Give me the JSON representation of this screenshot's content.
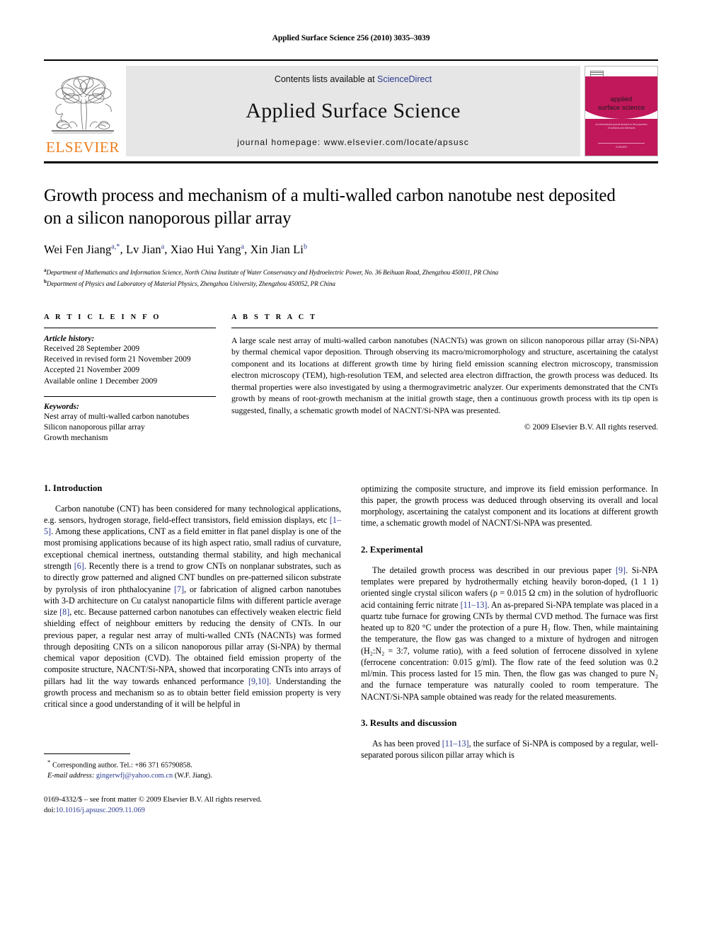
{
  "running_head": "Applied Surface Science 256 (2010) 3035–3039",
  "banner": {
    "contents_prefix": "Contents lists available at ",
    "sciencedirect": "ScienceDirect",
    "journal_name": "Applied Surface Science",
    "homepage": "journal homepage: www.elsevier.com/locate/apsusc",
    "publisher_wordmark": "ELSEVIER",
    "cover": {
      "title_line1": "applied",
      "title_line2": "surface science",
      "subtitle": "An international journal devoted to the properties of surfaces and interfaces",
      "footer": "ELSEVIER",
      "accent_color": "#c0185b"
    },
    "link_color": "#2b3a8f",
    "wordmark_color": "#ef7d1a"
  },
  "article": {
    "title": "Growth process and mechanism of a multi-walled carbon nanotube nest deposited on a silicon nanoporous pillar array",
    "authors_html": "Wei Fen Jiang <sup>a,*</sup>, Lv Jian <sup>a</sup>, Xiao Hui Yang <sup>a</sup>, Xin Jian Li <sup>b</sup>",
    "affiliations": [
      {
        "marker": "a",
        "text": "Department of Mathematics and Information Science, North China Institute of Water Conservancy and Hydroelectric Power, No. 36 Beihuan Road, Zhengzhou 450011, PR China"
      },
      {
        "marker": "b",
        "text": "Department of Physics and Laboratory of Material Physics, Zhengzhou University, Zhengzhou 450052, PR China"
      }
    ]
  },
  "article_info": {
    "label": "A R T I C L E   I N F O",
    "history_head": "Article history:",
    "history": [
      "Received 28 September 2009",
      "Received in revised form 21 November 2009",
      "Accepted 21 November 2009",
      "Available online 1 December 2009"
    ],
    "keywords_head": "Keywords:",
    "keywords": [
      "Nest array of multi-walled carbon nanotubes",
      "Silicon nanoporous pillar array",
      "Growth mechanism"
    ]
  },
  "abstract": {
    "label": "A B S T R A C T",
    "text": "A large scale nest array of multi-walled carbon nanotubes (NACNTs) was grown on silicon nanoporous pillar array (Si-NPA) by thermal chemical vapor deposition. Through observing its macro/micromorphology and structure, ascertaining the catalyst component and its locations at different growth time by hiring field emission scanning electron microscopy, transmission electron microscopy (TEM), high-resolution TEM, and selected area electron diffraction, the growth process was deduced. Its thermal properties were also investigated by using a thermogravimetric analyzer. Our experiments demonstrated that the CNTs growth by means of root-growth mechanism at the initial growth stage, then a continuous growth process with its tip open is suggested, finally, a schematic growth model of NACNT/Si-NPA was presented.",
    "copyright": "© 2009 Elsevier B.V. All rights reserved."
  },
  "sections": {
    "introduction_head": "1. Introduction",
    "intro_p1_a": "Carbon nanotube (CNT) has been considered for many technological applications, e.g. sensors, hydrogen storage, field-effect transistors, field emission displays, etc ",
    "intro_ref1": "[1–5]",
    "intro_p1_b": ". Among these applications, CNT as a field emitter in flat panel display is one of the most promising applications because of its high aspect ratio, small radius of curvature, exceptional chemical inertness, outstanding thermal stability, and high mechanical strength ",
    "intro_ref2": "[6]",
    "intro_p1_c": ". Recently there is a trend to grow CNTs on nonplanar substrates, such as to directly grow patterned and aligned CNT bundles on pre-patterned silicon substrate by pyrolysis of iron phthalocyanine ",
    "intro_ref3": "[7]",
    "intro_p1_d": ", or fabrication of aligned carbon nanotubes with 3-D architecture on Cu catalyst nanoparticle films with different particle average size ",
    "intro_ref4": "[8]",
    "intro_p1_e": ", etc. Because patterned carbon nanotubes can effectively weaken electric field shielding effect of neighbour emitters by reducing the density of CNTs. In our previous paper, a regular nest array of multi-walled CNTs (NACNTs) was formed through depositing CNTs on a silicon nanoporous pillar array (Si-NPA) by thermal chemical vapor deposition (CVD). The obtained field emission property of the composite structure, NACNT/Si-NPA, showed that incorporating CNTs into arrays of pillars had lit the way towards enhanced performance ",
    "intro_ref5": "[9,10]",
    "intro_p1_f": ". Understanding the growth process and mechanism so as to obtain better field emission property is very critical since a good understanding of it will be helpful in",
    "intro_p2": "optimizing the composite structure, and improve its field emission performance. In this paper, the growth process was deduced through observing its overall and local morphology, ascertaining the catalyst component and its locations at different growth time, a schematic growth model of NACNT/Si-NPA was presented.",
    "experimental_head": "2. Experimental",
    "exp_a": "The detailed growth process was described in our previous paper ",
    "exp_ref1": "[9]",
    "exp_b": ". Si-NPA templates were prepared by hydrothermally etching heavily boron-doped, (1 1 1) oriented single crystal silicon wafers (ρ = 0.015 Ω cm) in the solution of hydrofluoric acid containing ferric nitrate ",
    "exp_ref2": "[11–13]",
    "exp_c": ". An as-prepared Si-NPA template was placed in a quartz tube furnace for growing CNTs by thermal CVD method. The furnace was first heated up to 820 °C under the protection of a pure H₂ flow. Then, while maintaining the temperature, the flow gas was changed to a mixture of hydrogen and nitrogen (H₂:N₂ = 3:7, volume ratio), with a feed solution of ferrocene dissolved in xylene (ferrocene concentration: 0.015 g/ml). The flow rate of the feed solution was 0.2 ml/min. This process lasted for 15 min. Then, the flow gas was changed to pure N₂ and the furnace temperature was naturally cooled to room temperature. The NACNT/Si-NPA sample obtained was ready for the related measurements.",
    "results_head": "3. Results and discussion",
    "res_a": "As has been proved ",
    "res_ref1": "[11–13]",
    "res_b": ", the surface of Si-NPA is composed by a regular, well-separated porous silicon pillar array which is"
  },
  "footnotes": {
    "corresponding_marker": "*",
    "corresponding": "Corresponding author. Tel.: +86 371 65790858.",
    "email_label": "E-mail address:",
    "email": "gingerwfj@yahoo.com.cn",
    "email_owner": "(W.F. Jiang).",
    "issn_line": "0169-4332/$ – see front matter © 2009 Elsevier B.V. All rights reserved.",
    "doi_label": "doi:",
    "doi": "10.1016/j.apsusc.2009.11.069"
  }
}
